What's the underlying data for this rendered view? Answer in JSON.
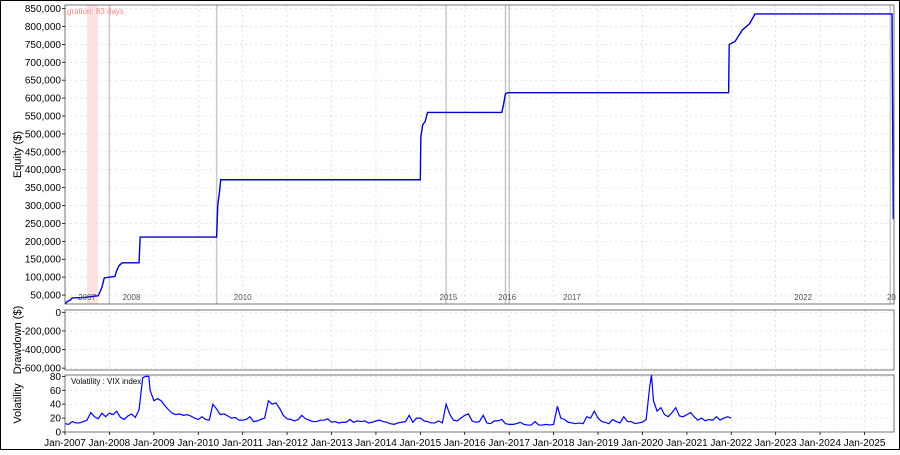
{
  "chart_data": [
    {
      "type": "line",
      "ylabel": "Equity ($)",
      "ylim": [
        25000,
        860000
      ],
      "yticks": [
        50000,
        100000,
        150000,
        200000,
        250000,
        300000,
        350000,
        400000,
        450000,
        500000,
        550000,
        600000,
        650000,
        700000,
        750000,
        800000,
        850000
      ],
      "ytick_labels": [
        "50,000",
        "100,000",
        "150,000",
        "200,000",
        "250,000",
        "300,000",
        "350,000",
        "400,000",
        "450,000",
        "500,000",
        "550,000",
        "600,000",
        "650,000",
        "700,000",
        "750,000",
        "800,000",
        "850,000"
      ],
      "annotation": "gration: 83 days",
      "shaded_region": [
        "2007-07",
        "2007-10"
      ],
      "trade_markers": [
        "2008-01",
        "2010-06",
        "2015-08",
        "2016-12",
        "2017-01",
        "2025-08"
      ],
      "trade_marker_labels": [
        "2007",
        "2008",
        "2010",
        "2015",
        "2016",
        "2017",
        "2022",
        "20"
      ],
      "color": "#0000cc",
      "series": [
        {
          "points": [
            [
              "2007-01-01",
              25000
            ],
            [
              "2007-01-20",
              32000
            ],
            [
              "2007-02-15",
              36000
            ],
            [
              "2007-03-01",
              42000
            ],
            [
              "2007-06-01",
              43000
            ],
            [
              "2007-09-01",
              47000
            ],
            [
              "2007-10-01",
              48000
            ],
            [
              "2007-10-20",
              62000
            ],
            [
              "2007-11-01",
              72000
            ],
            [
              "2007-11-20",
              98000
            ],
            [
              "2008-01-01",
              100000
            ],
            [
              "2008-02-15",
              102000
            ],
            [
              "2008-03-01",
              118000
            ],
            [
              "2008-03-20",
              132000
            ],
            [
              "2008-04-15",
              140000
            ],
            [
              "2008-09-01",
              140000
            ],
            [
              "2008-09-10",
              212000
            ],
            [
              "2010-06-01",
              212000
            ],
            [
              "2010-06-10",
              300000
            ],
            [
              "2010-06-25",
              340000
            ],
            [
              "2010-07-05",
              372000
            ],
            [
              "2015-01-01",
              372000
            ],
            [
              "2015-01-05",
              490000
            ],
            [
              "2015-01-20",
              525000
            ],
            [
              "2015-02-10",
              535000
            ],
            [
              "2015-03-01",
              560000
            ],
            [
              "2016-11-01",
              560000
            ],
            [
              "2016-11-15",
              582000
            ],
            [
              "2016-12-01",
              612000
            ],
            [
              "2016-12-20",
              615000
            ],
            [
              "2021-12-10",
              615000
            ],
            [
              "2021-12-15",
              750000
            ],
            [
              "2022-02-01",
              758000
            ],
            [
              "2022-04-01",
              790000
            ],
            [
              "2022-06-01",
              808000
            ],
            [
              "2022-07-15",
              835000
            ],
            [
              "2025-08-15",
              835000
            ],
            [
              "2025-08-25",
              262000
            ]
          ]
        }
      ]
    },
    {
      "type": "line",
      "ylabel": "Drawdown ($)",
      "ylim": [
        -620000,
        25000
      ],
      "yticks": [
        0,
        -200000,
        -400000,
        -600000
      ],
      "ytick_labels": [
        "0",
        "-200,000",
        "-400,000",
        "-600,000"
      ]
    },
    {
      "type": "line",
      "ylabel": "Volatility",
      "series_label": "Volatility : VIX index",
      "ylim": [
        0,
        82
      ],
      "yticks": [
        0,
        20,
        40,
        60,
        80
      ],
      "ytick_labels": [
        "0",
        "20",
        "40",
        "60",
        "80"
      ],
      "color": "#0000ff",
      "x_ticks": [
        "Jan-2007",
        "Jan-2008",
        "Jan-2009",
        "Jan-2010",
        "Jan-2011",
        "Jan-2012",
        "Jan-2013",
        "Jan-2014",
        "Jan-2015",
        "Jan-2016",
        "Jan-2017",
        "Jan-2018",
        "Jan-2019",
        "Jan-2020",
        "Jan-2021",
        "Jan-2022",
        "Jan-2023",
        "Jan-2024",
        "Jan-2025"
      ],
      "xlim": [
        "2007-01-01",
        "2025-08-31"
      ],
      "series": [
        {
          "points": [
            [
              "2007-01-01",
              12
            ],
            [
              "2007-02-01",
              11
            ],
            [
              "2007-03-01",
              15
            ],
            [
              "2007-04-01",
              13
            ],
            [
              "2007-05-01",
              13
            ],
            [
              "2007-06-01",
              15
            ],
            [
              "2007-07-01",
              17
            ],
            [
              "2007-08-01",
              28
            ],
            [
              "2007-09-01",
              22
            ],
            [
              "2007-10-01",
              19
            ],
            [
              "2007-11-01",
              27
            ],
            [
              "2007-12-01",
              22
            ],
            [
              "2008-01-01",
              27
            ],
            [
              "2008-02-01",
              25
            ],
            [
              "2008-03-01",
              30
            ],
            [
              "2008-04-01",
              21
            ],
            [
              "2008-05-01",
              18
            ],
            [
              "2008-06-01",
              23
            ],
            [
              "2008-07-01",
              26
            ],
            [
              "2008-08-01",
              21
            ],
            [
              "2008-09-01",
              32
            ],
            [
              "2008-10-01",
              78
            ],
            [
              "2008-10-24",
              80
            ],
            [
              "2008-11-20",
              80
            ],
            [
              "2008-12-01",
              60
            ],
            [
              "2009-01-01",
              45
            ],
            [
              "2009-02-01",
              48
            ],
            [
              "2009-03-01",
              45
            ],
            [
              "2009-04-01",
              38
            ],
            [
              "2009-05-01",
              32
            ],
            [
              "2009-06-01",
              27
            ],
            [
              "2009-07-01",
              25
            ],
            [
              "2009-08-01",
              26
            ],
            [
              "2009-09-01",
              24
            ],
            [
              "2009-10-01",
              25
            ],
            [
              "2009-11-01",
              23
            ],
            [
              "2009-12-01",
              20
            ],
            [
              "2010-01-01",
              18
            ],
            [
              "2010-02-01",
              22
            ],
            [
              "2010-03-01",
              18
            ],
            [
              "2010-04-01",
              17
            ],
            [
              "2010-05-01",
              40
            ],
            [
              "2010-06-01",
              33
            ],
            [
              "2010-07-01",
              25
            ],
            [
              "2010-08-01",
              26
            ],
            [
              "2010-09-01",
              23
            ],
            [
              "2010-10-01",
              20
            ],
            [
              "2010-11-01",
              21
            ],
            [
              "2010-12-01",
              17
            ],
            [
              "2011-01-01",
              17
            ],
            [
              "2011-02-01",
              18
            ],
            [
              "2011-03-01",
              22
            ],
            [
              "2011-04-01",
              15
            ],
            [
              "2011-05-01",
              16
            ],
            [
              "2011-06-01",
              18
            ],
            [
              "2011-07-01",
              20
            ],
            [
              "2011-08-01",
              45
            ],
            [
              "2011-09-01",
              40
            ],
            [
              "2011-10-01",
              42
            ],
            [
              "2011-11-01",
              34
            ],
            [
              "2011-12-01",
              24
            ],
            [
              "2012-01-01",
              19
            ],
            [
              "2012-02-01",
              18
            ],
            [
              "2012-03-01",
              16
            ],
            [
              "2012-04-01",
              18
            ],
            [
              "2012-05-01",
              24
            ],
            [
              "2012-06-01",
              19
            ],
            [
              "2012-07-01",
              17
            ],
            [
              "2012-08-01",
              15
            ],
            [
              "2012-09-01",
              15
            ],
            [
              "2012-10-01",
              17
            ],
            [
              "2012-11-01",
              17
            ],
            [
              "2012-12-01",
              19
            ],
            [
              "2013-01-01",
              14
            ],
            [
              "2013-02-01",
              15
            ],
            [
              "2013-03-01",
              13
            ],
            [
              "2013-04-01",
              14
            ],
            [
              "2013-05-01",
              14
            ],
            [
              "2013-06-01",
              18
            ],
            [
              "2013-07-01",
              14
            ],
            [
              "2013-08-01",
              16
            ],
            [
              "2013-09-01",
              15
            ],
            [
              "2013-10-01",
              16
            ],
            [
              "2013-11-01",
              13
            ],
            [
              "2013-12-01",
              14
            ],
            [
              "2014-01-01",
              16
            ],
            [
              "2014-02-01",
              17
            ],
            [
              "2014-03-01",
              15
            ],
            [
              "2014-04-01",
              14
            ],
            [
              "2014-05-01",
              12
            ],
            [
              "2014-06-01",
              11
            ],
            [
              "2014-07-01",
              13
            ],
            [
              "2014-08-01",
              14
            ],
            [
              "2014-09-01",
              15
            ],
            [
              "2014-10-01",
              24
            ],
            [
              "2014-11-01",
              14
            ],
            [
              "2014-12-01",
              20
            ],
            [
              "2015-01-01",
              20
            ],
            [
              "2015-02-01",
              16
            ],
            [
              "2015-03-01",
              15
            ],
            [
              "2015-04-01",
              13
            ],
            [
              "2015-05-01",
              13
            ],
            [
              "2015-06-01",
              16
            ],
            [
              "2015-07-01",
              13
            ],
            [
              "2015-08-01",
              40
            ],
            [
              "2015-09-01",
              25
            ],
            [
              "2015-10-01",
              17
            ],
            [
              "2015-11-01",
              16
            ],
            [
              "2015-12-01",
              20
            ],
            [
              "2016-01-01",
              24
            ],
            [
              "2016-02-01",
              26
            ],
            [
              "2016-03-01",
              16
            ],
            [
              "2016-04-01",
              14
            ],
            [
              "2016-05-01",
              15
            ],
            [
              "2016-06-01",
              24
            ],
            [
              "2016-07-01",
              13
            ],
            [
              "2016-08-01",
              12
            ],
            [
              "2016-09-01",
              16
            ],
            [
              "2016-10-01",
              16
            ],
            [
              "2016-11-01",
              18
            ],
            [
              "2016-12-01",
              12
            ],
            [
              "2017-01-01",
              11
            ],
            [
              "2017-02-01",
              11
            ],
            [
              "2017-03-01",
              12
            ],
            [
              "2017-04-01",
              14
            ],
            [
              "2017-05-01",
              11
            ],
            [
              "2017-06-01",
              10
            ],
            [
              "2017-07-01",
              10
            ],
            [
              "2017-08-01",
              15
            ],
            [
              "2017-09-01",
              10
            ],
            [
              "2017-10-01",
              10
            ],
            [
              "2017-11-01",
              11
            ],
            [
              "2017-12-01",
              10
            ],
            [
              "2018-01-01",
              11
            ],
            [
              "2018-02-01",
              37
            ],
            [
              "2018-03-01",
              20
            ],
            [
              "2018-04-01",
              18
            ],
            [
              "2018-05-01",
              14
            ],
            [
              "2018-06-01",
              13
            ],
            [
              "2018-07-01",
              12
            ],
            [
              "2018-08-01",
              13
            ],
            [
              "2018-09-01",
              12
            ],
            [
              "2018-10-01",
              22
            ],
            [
              "2018-11-01",
              20
            ],
            [
              "2018-12-01",
              30
            ],
            [
              "2019-01-01",
              20
            ],
            [
              "2019-02-01",
              15
            ],
            [
              "2019-03-01",
              14
            ],
            [
              "2019-04-01",
              12
            ],
            [
              "2019-05-01",
              18
            ],
            [
              "2019-06-01",
              15
            ],
            [
              "2019-07-01",
              13
            ],
            [
              "2019-08-01",
              22
            ],
            [
              "2019-09-01",
              15
            ],
            [
              "2019-10-01",
              15
            ],
            [
              "2019-11-01",
              12
            ],
            [
              "2019-12-01",
              13
            ],
            [
              "2020-01-01",
              14
            ],
            [
              "2020-02-01",
              18
            ],
            [
              "2020-03-01",
              65
            ],
            [
              "2020-03-16",
              82
            ],
            [
              "2020-04-01",
              45
            ],
            [
              "2020-05-01",
              30
            ],
            [
              "2020-06-01",
              35
            ],
            [
              "2020-07-01",
              25
            ],
            [
              "2020-08-01",
              22
            ],
            [
              "2020-09-01",
              28
            ],
            [
              "2020-10-01",
              35
            ],
            [
              "2020-11-01",
              23
            ],
            [
              "2020-12-01",
              22
            ],
            [
              "2021-01-01",
              25
            ],
            [
              "2021-02-01",
              28
            ],
            [
              "2021-03-01",
              22
            ],
            [
              "2021-04-01",
              17
            ],
            [
              "2021-05-01",
              20
            ],
            [
              "2021-06-01",
              16
            ],
            [
              "2021-07-01",
              18
            ],
            [
              "2021-08-01",
              17
            ],
            [
              "2021-09-01",
              22
            ],
            [
              "2021-10-01",
              17
            ],
            [
              "2021-11-01",
              20
            ],
            [
              "2021-12-01",
              22
            ],
            [
              "2022-01-01",
              20
            ]
          ]
        }
      ]
    }
  ]
}
